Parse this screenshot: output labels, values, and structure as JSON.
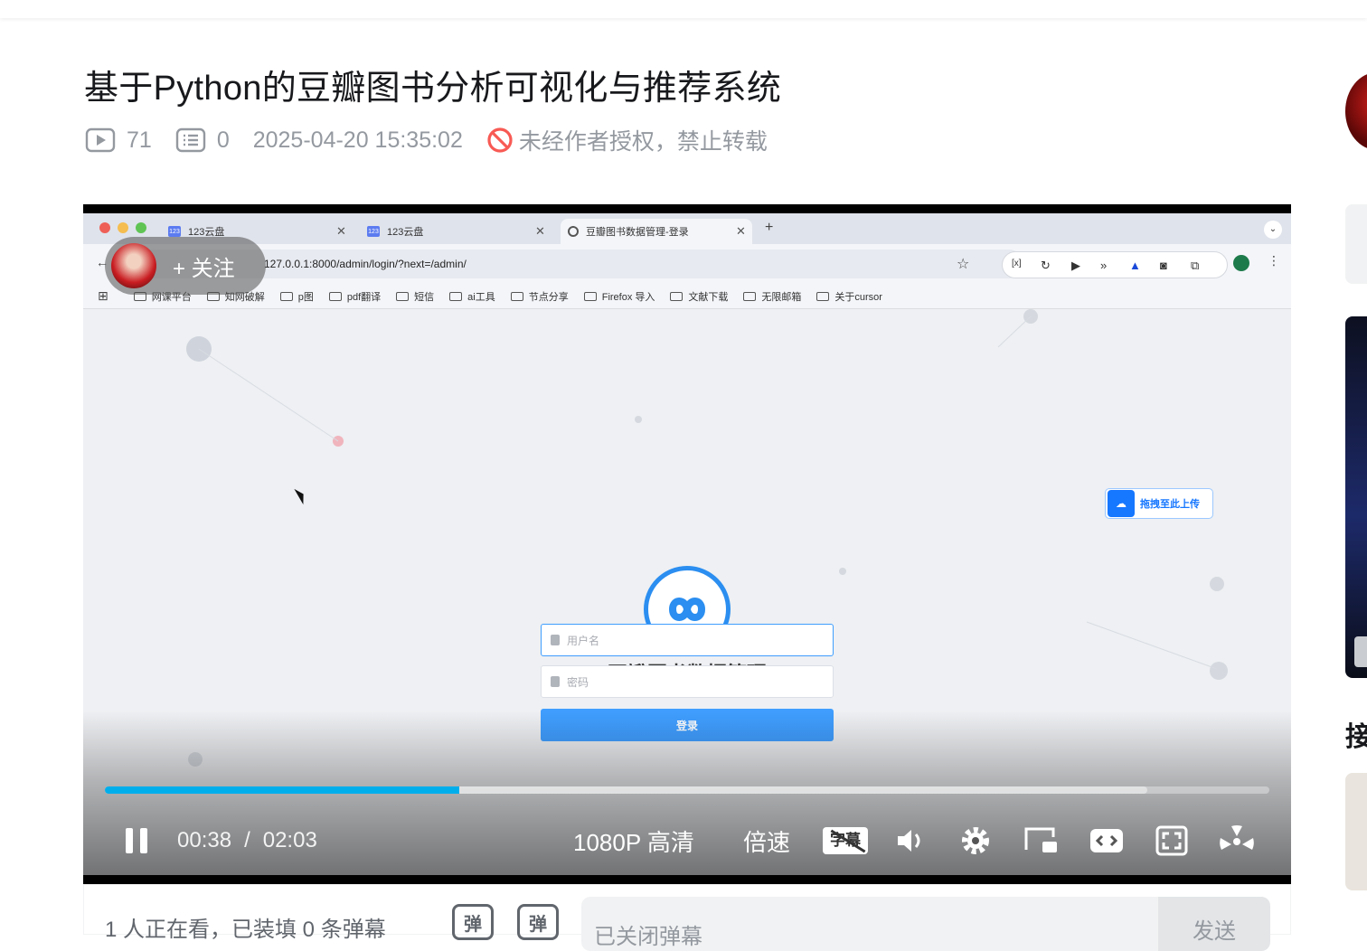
{
  "video": {
    "title": "基于Python的豆瓣图书分析可视化与推荐系统",
    "play_count": "71",
    "comment_count": "0",
    "publish_time": "2025-04-20 15:35:02",
    "copyright_notice": "未经作者授权，禁止转载"
  },
  "browser": {
    "tabs": [
      {
        "label": "123云盘"
      },
      {
        "label": "123云盘"
      },
      {
        "label": "豆瓣图书数据管理-登录"
      }
    ],
    "url": "127.0.0.1:8000/admin/login/?next=/admin/",
    "bookmarks": [
      "网课平台",
      "知网破解",
      "p图",
      "pdf翻译",
      "短信",
      "ai工具",
      "节点分享",
      "Firefox 导入",
      "文献下载",
      "无限邮箱",
      "关于cursor"
    ]
  },
  "login_page": {
    "app_title": "豆瓣图书数据管理",
    "username_placeholder": "用户名",
    "password_placeholder": "密码",
    "login_button": "登录",
    "drag_upload": "拖拽至此上传"
  },
  "overlay": {
    "follow_label": "+ 关注"
  },
  "player": {
    "current_time": "00:38",
    "separator": "/",
    "duration": "02:03",
    "played_fraction": 0.304,
    "buffered_fraction": 0.895,
    "quality_label": "1080P 高清",
    "speed_label": "倍速",
    "subtitle_label": "字幕"
  },
  "danmaku": {
    "watching_text": "1 人正在看，已装填 0 条弹幕",
    "input_placeholder": "已关闭弹幕",
    "send_label": "发送",
    "icon_label": "弹"
  },
  "sidebar": {
    "heading_partial": "接"
  }
}
